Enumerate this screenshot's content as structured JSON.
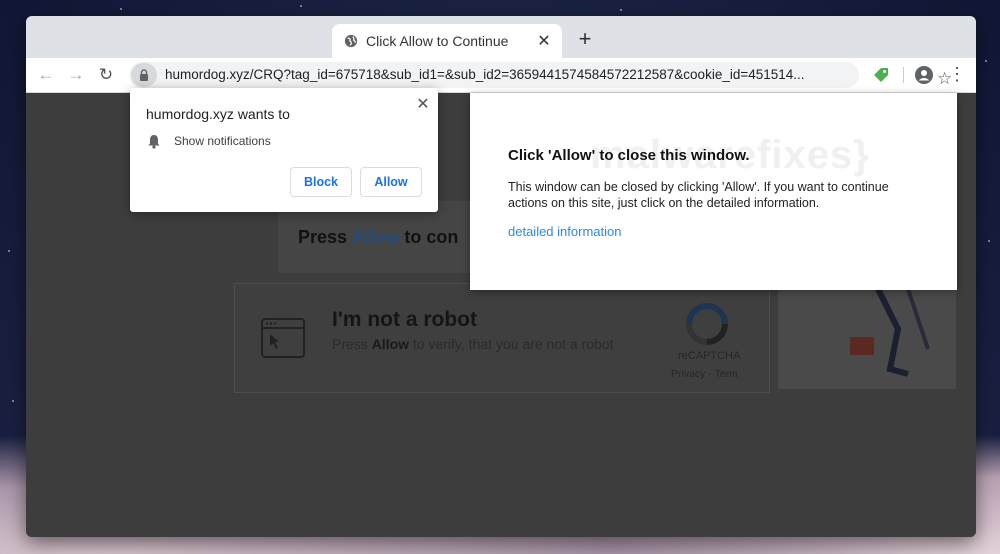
{
  "tab": {
    "title": "Click Allow to Continue",
    "close_glyph": "✕",
    "new_tab_glyph": "+"
  },
  "toolbar": {
    "back_glyph": "←",
    "forward_glyph": "→",
    "reload_glyph": "↻",
    "url": "humordog.xyz/CRQ?tag_id=675718&sub_id1=&sub_id2=3659441574584572212587&cookie_id=451514...",
    "bookmark_glyph": "☆",
    "menu_glyph": "⋮"
  },
  "permission_popup": {
    "title": "humordog.xyz wants to",
    "permission": "Show notifications",
    "block_label": "Block",
    "allow_label": "Allow",
    "close_glyph": "✕"
  },
  "page": {
    "press_allow_prefix": "Press ",
    "press_allow_highlight": "Allow",
    "press_allow_suffix": " to con",
    "robot_title": "I'm not a robot",
    "robot_sub_prefix": "Press ",
    "robot_sub_bold": "Allow",
    "robot_sub_suffix": " to verify, that you are not a robot",
    "recaptcha_label": "reCAPTCHA",
    "recaptcha_terms": "Privacy - Term"
  },
  "overlay": {
    "watermark": "malwarefixes}",
    "title": "Click 'Allow' to close this window.",
    "body": "This window can be closed by clicking 'Allow'. If you want to continue actions on this site, just click on the detailed information.",
    "link": "detailed information"
  },
  "colors": {
    "link": "#2f89d6",
    "button_text": "#1a73e8",
    "extension": "#4caf50"
  }
}
